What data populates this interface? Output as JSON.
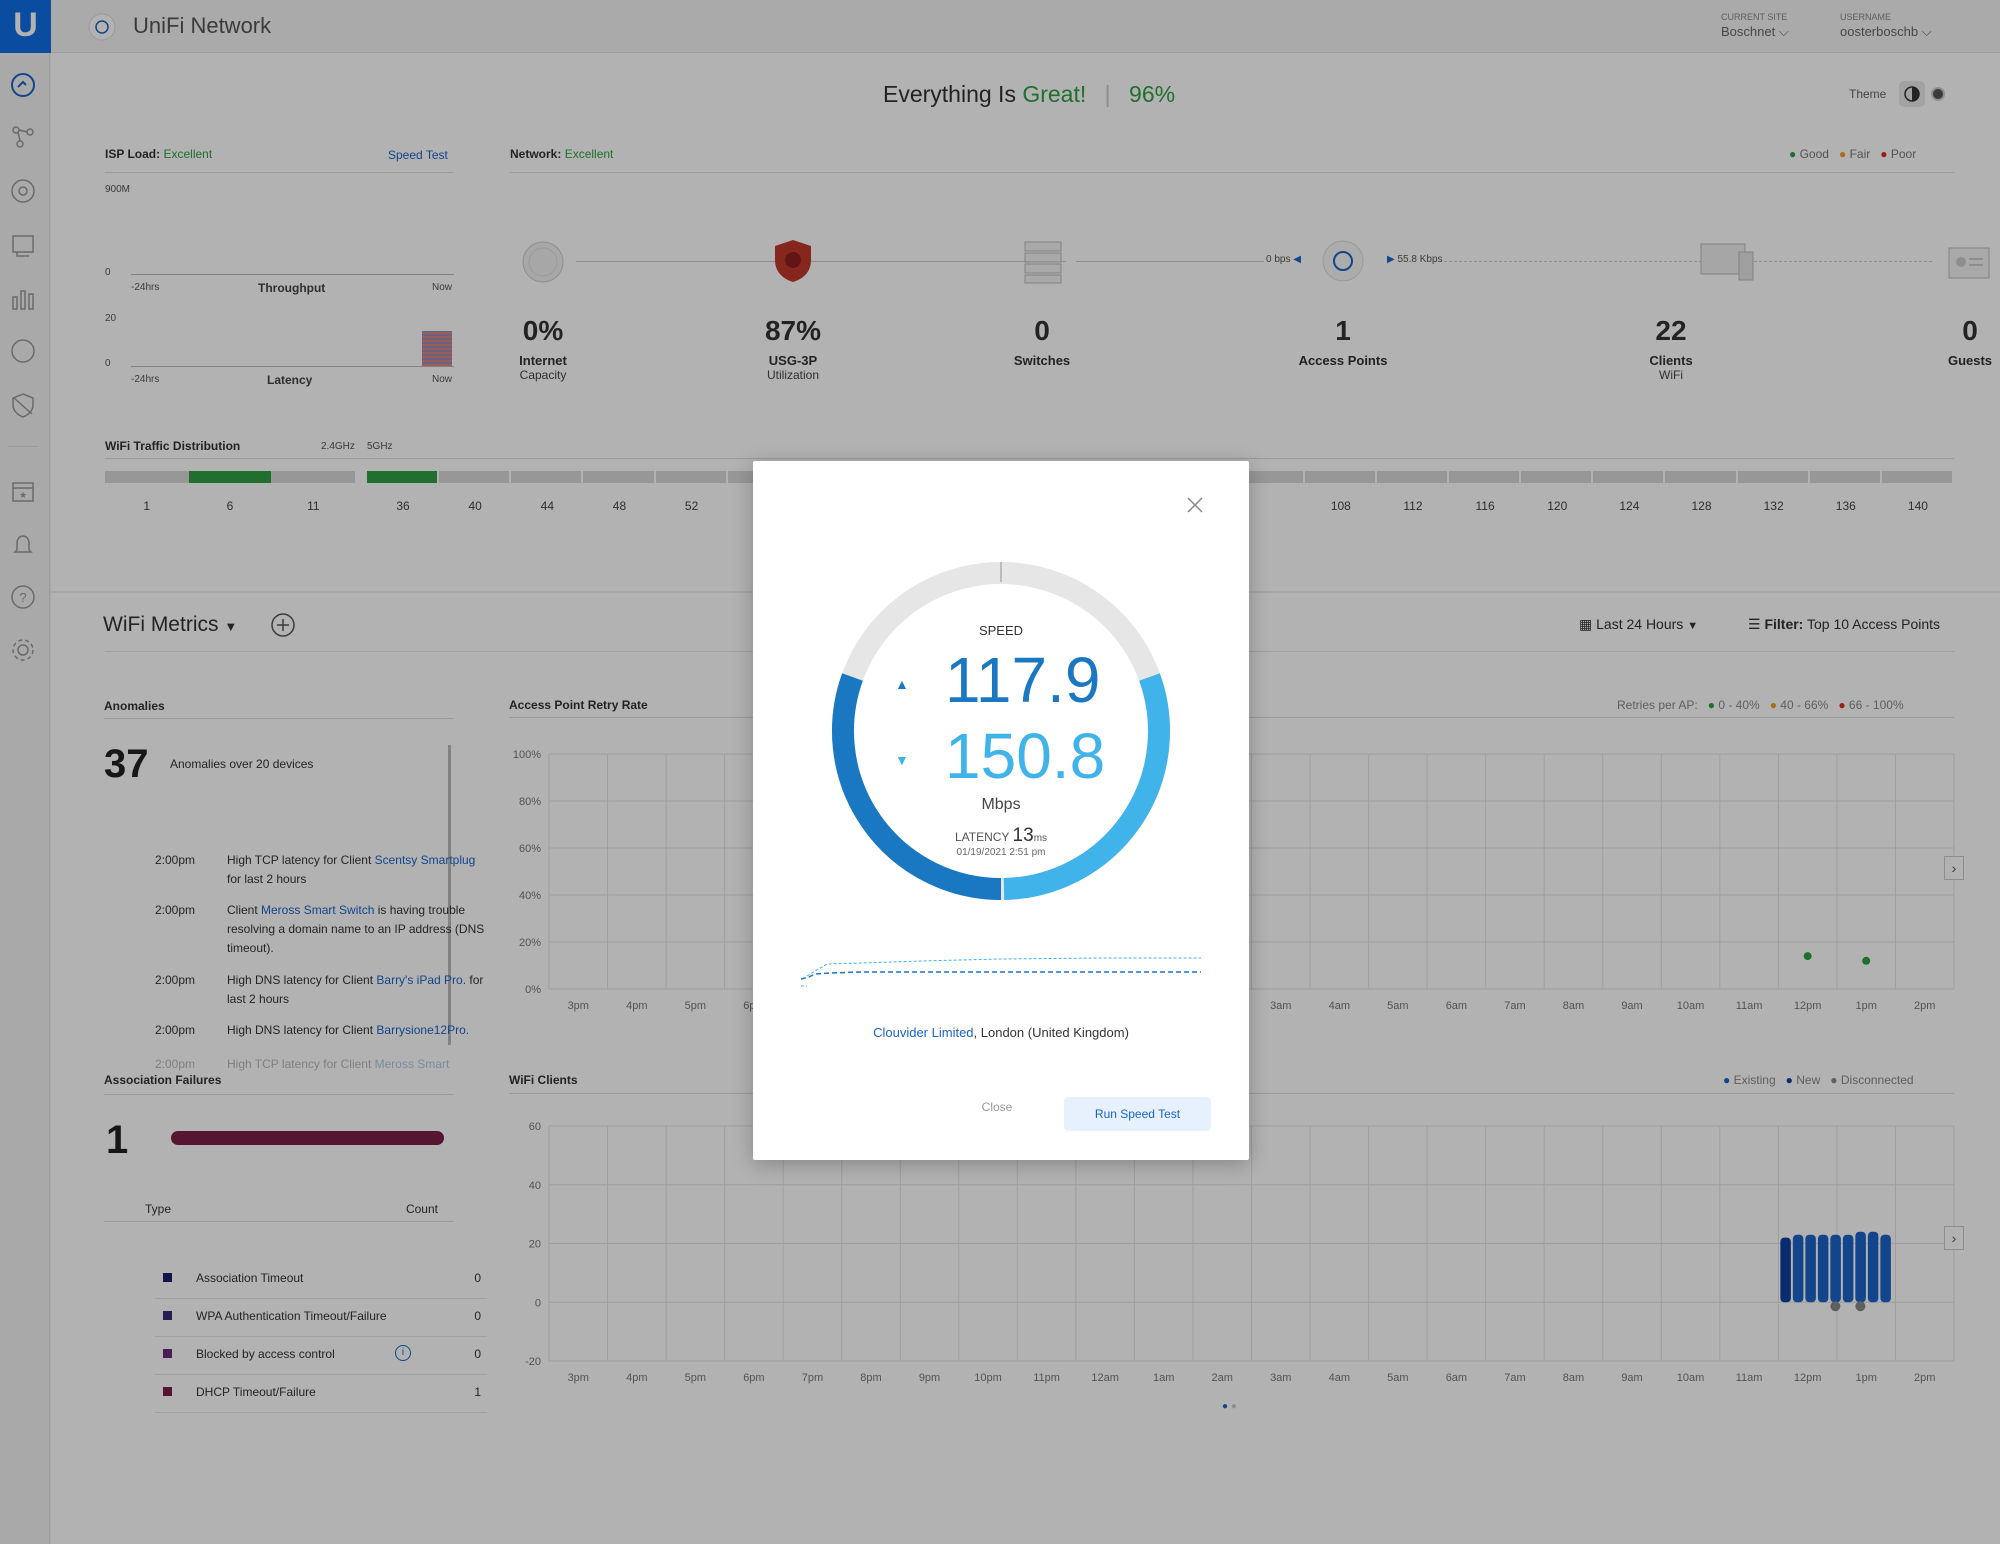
{
  "header": {
    "app_name": "UniFi Network",
    "current_site_label": "CURRENT SITE",
    "current_site_value": "Boschnet",
    "username_label": "USERNAME",
    "username_value": "oosterboschb"
  },
  "status": {
    "prefix": "Everything Is",
    "word": "Great!",
    "score": "96%",
    "theme_label": "Theme"
  },
  "isp": {
    "title": "ISP Load:",
    "rating": "Excellent",
    "speed_test_link": "Speed Test",
    "throughput_max": "900M",
    "throughput_min": "0",
    "throughput_start": "-24hrs",
    "throughput_label": "Throughput",
    "throughput_end": "Now",
    "latency_max": "20",
    "latency_min": "0",
    "latency_start": "-24hrs",
    "latency_label": "Latency",
    "latency_end": "Now"
  },
  "network": {
    "title": "Network:",
    "rating": "Excellent",
    "legend": [
      "Good",
      "Fair",
      "Poor"
    ],
    "legend_colors": [
      "#2ea043",
      "#f0a020",
      "#d93025"
    ],
    "ap_down_rate": "0 bps",
    "ap_up_rate": "55.8 Kbps",
    "stats": [
      {
        "value": "0%",
        "label": "Internet",
        "sub": "Capacity"
      },
      {
        "value": "87%",
        "label": "USG-3P",
        "sub": "Utilization"
      },
      {
        "value": "0",
        "label": "Switches",
        "sub": ""
      },
      {
        "value": "1",
        "label": "Access Points",
        "sub": ""
      },
      {
        "value": "22",
        "label": "Clients",
        "sub": "WiFi"
      },
      {
        "value": "0",
        "label": "Guests",
        "sub": ""
      }
    ]
  },
  "wifi_traffic": {
    "title": "WiFi Traffic Distribution",
    "band_24": "2.4GHz",
    "band_5": "5GHz",
    "channels_24": [
      "1",
      "6",
      "11"
    ],
    "channels_5": [
      "36",
      "40",
      "44",
      "48",
      "52",
      "",
      "",
      "",
      "",
      "",
      "",
      "",
      "",
      "108",
      "112",
      "116",
      "120",
      "124",
      "128",
      "132",
      "136",
      "140"
    ]
  },
  "metrics": {
    "title": "WiFi Metrics",
    "time_range": "Last 24 Hours",
    "filter_label": "Filter:",
    "filter_value": "Top 10 Access Points"
  },
  "anomalies": {
    "title": "Anomalies",
    "count": "37",
    "summary": "Anomalies over 20 devices",
    "items": [
      {
        "time": "2:00pm",
        "pre": "High TCP latency for Client ",
        "link": "Scentsy Smartplug",
        "post": " for last 2 hours"
      },
      {
        "time": "2:00pm",
        "pre": "Client ",
        "link": "Meross Smart Switch",
        "post": " is having trouble resolving a domain name to an IP address (DNS timeout)."
      },
      {
        "time": "2:00pm",
        "pre": "High DNS latency for Client ",
        "link": "Barry's iPad Pro.",
        "post": " for last 2 hours"
      },
      {
        "time": "2:00pm",
        "pre": "High DNS latency for Client ",
        "link": "Barrysione12Pro.",
        "post": ""
      },
      {
        "time": "2:00pm",
        "pre": "High TCP latency for Client ",
        "link": "Meross Smart",
        "post": ""
      }
    ]
  },
  "retry": {
    "title": "Access Point Retry Rate",
    "legend_title": "Retries per AP:",
    "legend": [
      "0 - 40%",
      "40 - 66%",
      "66 - 100%"
    ],
    "y_ticks": [
      "100%",
      "80%",
      "60%",
      "40%",
      "20%",
      "0%"
    ],
    "x_ticks": [
      "3pm",
      "4pm",
      "5pm",
      "6pm",
      "",
      "",
      "",
      "",
      "",
      "",
      "",
      "",
      "3am",
      "4am",
      "5am",
      "6am",
      "7am",
      "8am",
      "9am",
      "10am",
      "11am",
      "12pm",
      "1pm",
      "2pm"
    ]
  },
  "assoc": {
    "title": "Association Failures",
    "count": "1",
    "col_type": "Type",
    "col_count": "Count",
    "rows": [
      {
        "type": "Association Timeout",
        "count": "0",
        "color": "#1b1f6b"
      },
      {
        "type": "WPA Authentication Timeout/Failure",
        "count": "0",
        "color": "#3d2a7a"
      },
      {
        "type": "Blocked by access control",
        "count": "0",
        "color": "#6a2a7a"
      },
      {
        "type": "DHCP Timeout/Failure",
        "count": "1",
        "color": "#7a1f4a"
      }
    ]
  },
  "clients": {
    "title": "WiFi Clients",
    "legend": [
      "Existing",
      "New",
      "Disconnected"
    ],
    "y_ticks": [
      "60",
      "40",
      "20",
      "0",
      "-20"
    ],
    "x_ticks": [
      "3pm",
      "4pm",
      "5pm",
      "6pm",
      "7pm",
      "8pm",
      "9pm",
      "10pm",
      "11pm",
      "12am",
      "1am",
      "2am",
      "3am",
      "4am",
      "5am",
      "6am",
      "7am",
      "8am",
      "9am",
      "10am",
      "11am",
      "12pm",
      "1pm",
      "2pm"
    ]
  },
  "speedtest": {
    "speed_label": "SPEED",
    "upload": "117.9",
    "download": "150.8",
    "unit": "Mbps",
    "latency_label": "LATENCY",
    "latency_value": "13",
    "latency_unit": "ms",
    "timestamp": "01/19/2021 2:51 pm",
    "provider": "Clouvider Limited",
    "location": ", London (United Kingdom)",
    "close_button": "Close",
    "run_button": "Run Speed Test"
  }
}
